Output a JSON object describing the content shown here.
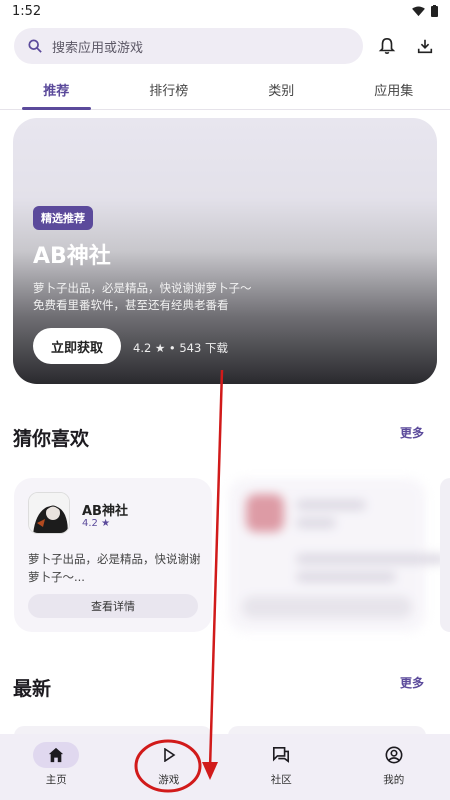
{
  "status_bar": {
    "time": "1:52"
  },
  "search": {
    "placeholder": "搜索应用或游戏"
  },
  "tabs": [
    {
      "label": "推荐",
      "active": true
    },
    {
      "label": "排行榜",
      "active": false
    },
    {
      "label": "类别",
      "active": false
    },
    {
      "label": "应用集",
      "active": false
    }
  ],
  "banner": {
    "badge": "精选推荐",
    "title": "AB神社",
    "desc_line1": "萝卜子出品，必是精品，快说谢谢萝卜子～",
    "desc_line2": "免费看里番软件，甚至还有经典老番看",
    "button": "立即获取",
    "meta": "4.2 ★ • 543 下载"
  },
  "sections": {
    "guess_title": "猜你喜欢",
    "guess_more": "更多",
    "latest_title": "最新",
    "latest_more": "更多"
  },
  "cards": [
    {
      "name": "AB神社",
      "rating": "4.2 ★",
      "desc": "萝卜子出品，必是精品，快说谢谢萝卜子～...",
      "button": "查看详情"
    }
  ],
  "bottom_nav": [
    {
      "label": "主页",
      "icon": "home-icon",
      "active": true
    },
    {
      "label": "游戏",
      "icon": "play-icon",
      "active": false
    },
    {
      "label": "社区",
      "icon": "chat-icon",
      "active": false
    },
    {
      "label": "我的",
      "icon": "profile-icon",
      "active": false
    }
  ],
  "colors": {
    "accent": "#5b4a9b",
    "annotation": "#d11a1a"
  }
}
